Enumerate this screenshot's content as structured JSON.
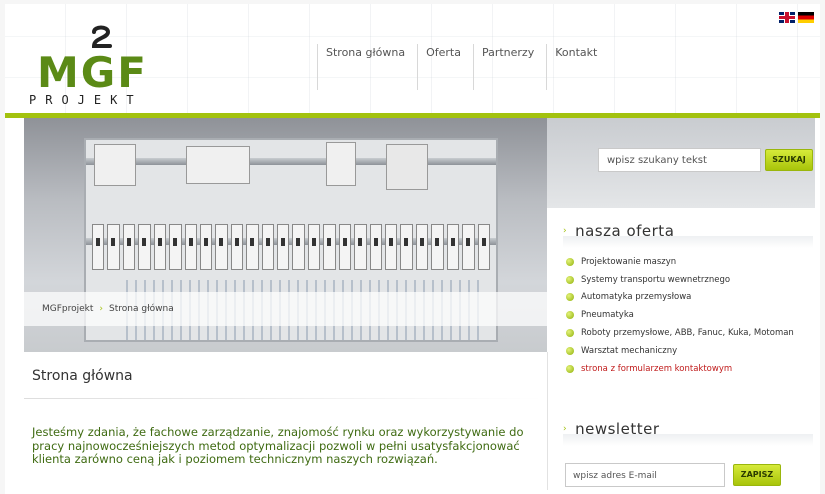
{
  "header": {
    "logo_text": "MGF",
    "logo_subtext": "PROJEKT",
    "nav": [
      "Strona główna",
      "Oferta",
      "Partnerzy",
      "Kontakt"
    ],
    "languages": [
      {
        "name": "en-flag-icon"
      },
      {
        "name": "de-flag-icon"
      }
    ]
  },
  "breadcrumb": {
    "items": [
      "MGFprojekt",
      "Strona główna"
    ],
    "separator": "›"
  },
  "search": {
    "placeholder": "wpisz szukany tekst",
    "button": "SZUKAJ"
  },
  "offer": {
    "title": "nasza oferta",
    "items": [
      "Projektowanie maszyn",
      "Systemy transportu wewnetrznego",
      "Automatyka przemysłowa",
      "Pneumatyka",
      "Roboty przemysłowe, ABB, Fanuc, Kuka, Motoman",
      "Warsztat mechaniczny",
      "strona z formularzem kontaktowym"
    ]
  },
  "newsletter": {
    "title": "newsletter",
    "placeholder": "wpisz adres E-mail",
    "button": "ZAPISZ"
  },
  "main": {
    "page_title": "Strona główna",
    "intro": "Jesteśmy zdania, że fachowe zarządzanie, znajomość rynku oraz wykorzystywanie do pracy najnowocześniejszych metod optymalizacji pozwoli w pełni usatysfakcjonować klienta zarówno ceną jak i poziomem technicznym naszych rozwiązań."
  },
  "colors": {
    "accent": "#a3c20e",
    "brand_green": "#5b8a16",
    "link_red": "#c01b1b"
  }
}
